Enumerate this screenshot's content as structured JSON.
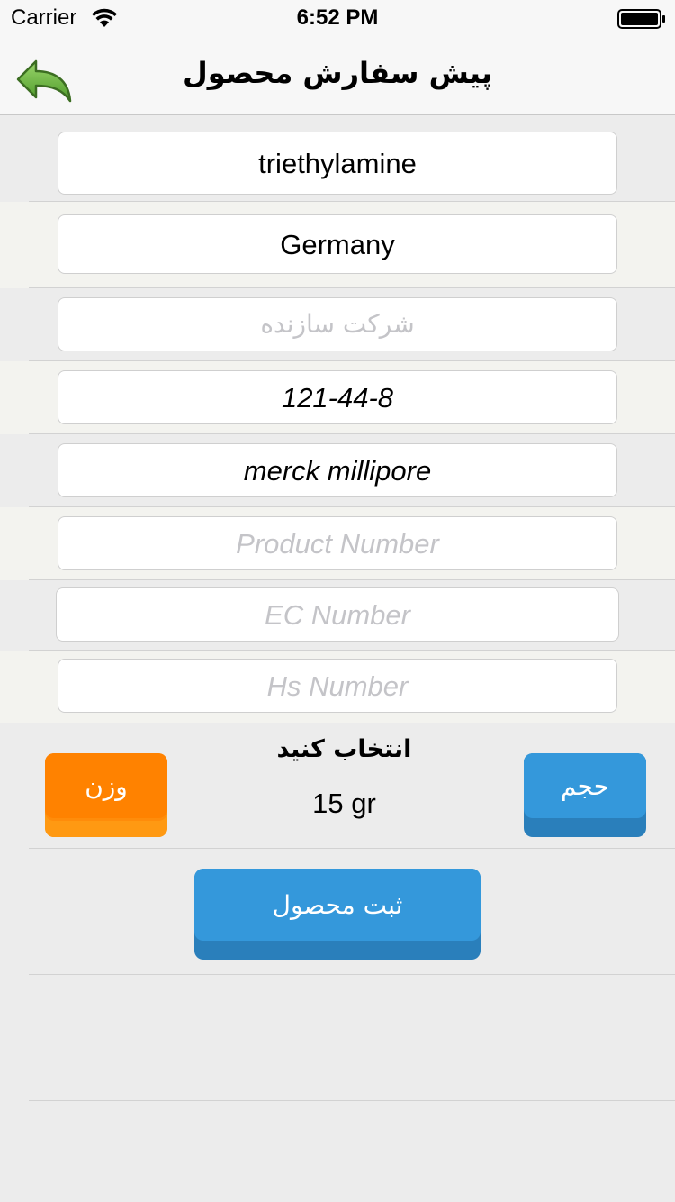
{
  "status": {
    "carrier": "Carrier",
    "time": "6:52 PM"
  },
  "nav": {
    "title": "پیش سفارش محصول",
    "back_icon": "back-arrow-icon"
  },
  "fields": {
    "name": {
      "value": "triethylamine"
    },
    "country": {
      "value": "Germany"
    },
    "manufacturer": {
      "placeholder": "شرکت سازنده"
    },
    "cas_number": {
      "value": "121-44-8"
    },
    "brand": {
      "value": "merck millipore"
    },
    "product_number": {
      "placeholder": "Product Number"
    },
    "ec_number": {
      "placeholder": "EC Number"
    },
    "hs_number": {
      "placeholder": "Hs Number"
    }
  },
  "selection": {
    "label": "انتخاب کنید",
    "amount": "15 gr",
    "weight_button": "وزن",
    "volume_button": "حجم"
  },
  "submit_button": "ثبت محصول",
  "colors": {
    "orange": "#ff8200",
    "blue": "#3498db",
    "background": "#ececec"
  }
}
